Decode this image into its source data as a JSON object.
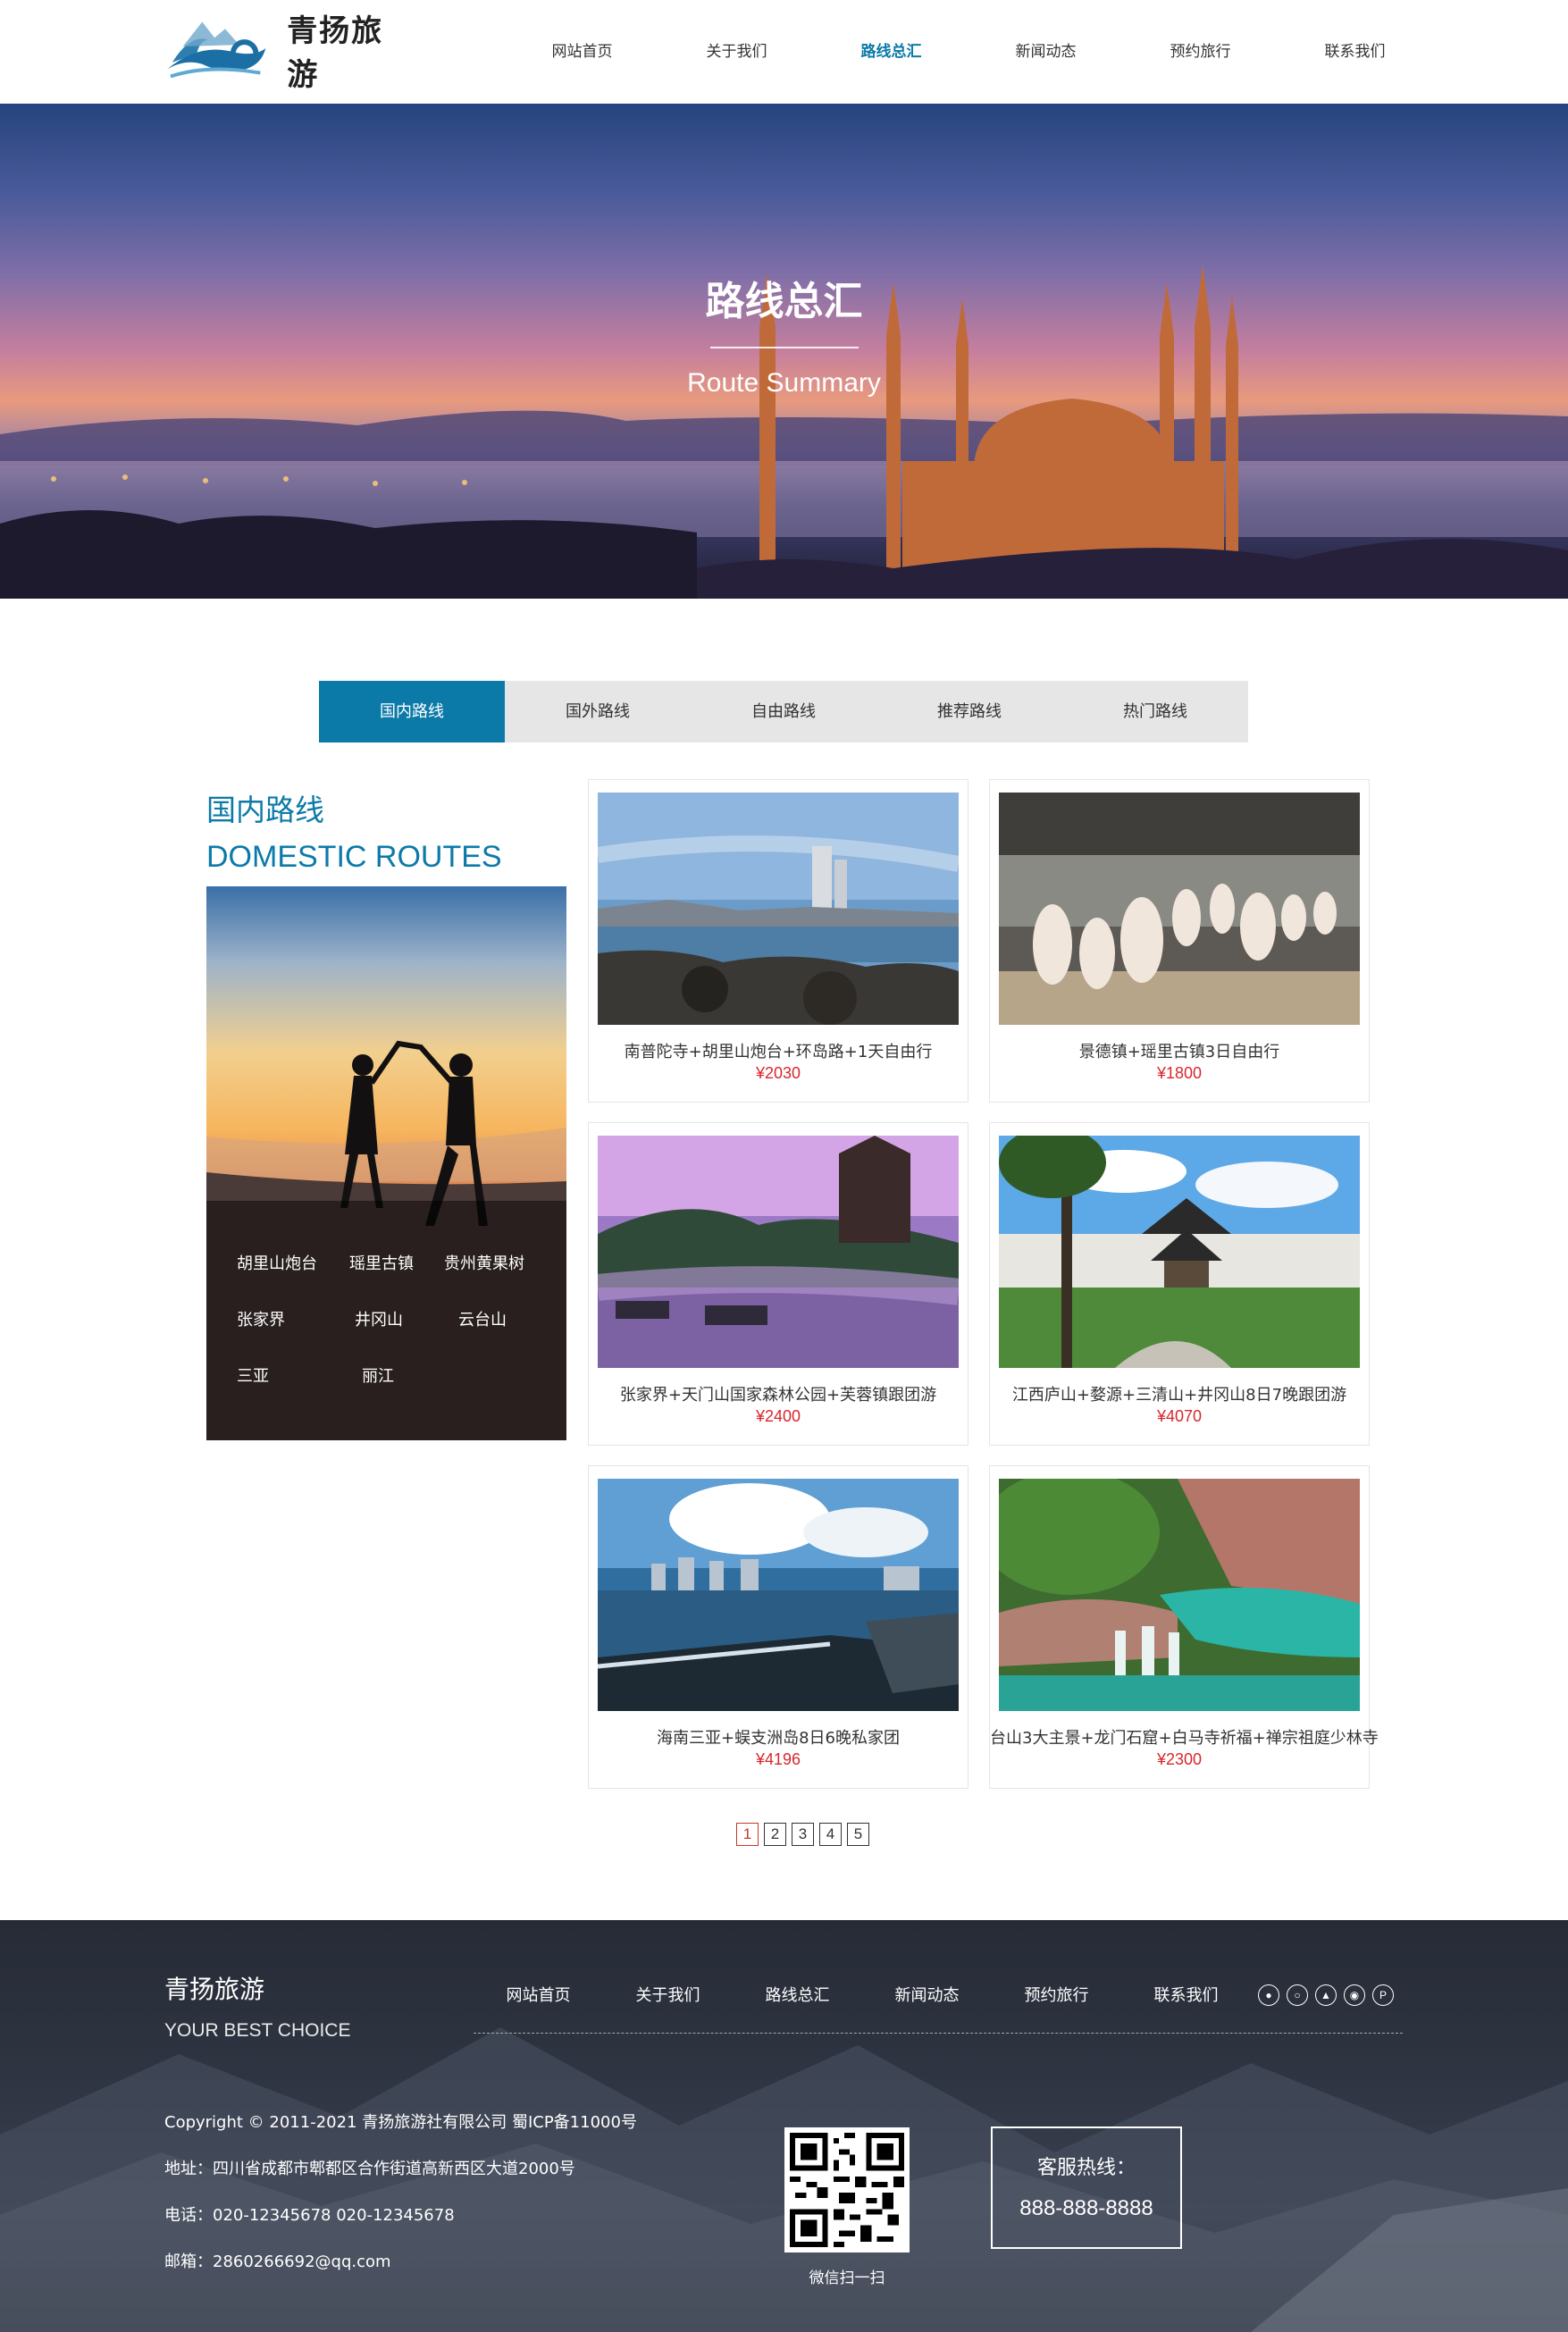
{
  "header": {
    "brand": "青扬旅游",
    "nav": [
      "网站首页",
      "关于我们",
      "路线总汇",
      "新闻动态",
      "预约旅行",
      "联系我们"
    ],
    "active_nav": 2
  },
  "banner": {
    "title": "路线总汇",
    "subtitle": "Route Summary"
  },
  "tabs": [
    "国内路线",
    "国外路线",
    "自由路线",
    "推荐路线",
    "热门路线"
  ],
  "sidebar": {
    "title_cn": "国内路线",
    "title_en": "DOMESTIC ROUTES",
    "tags": [
      "胡里山炮台",
      "瑶里古镇",
      "贵州黄果树",
      "张家界",
      "井冈山",
      "云台山",
      "三亚",
      "丽江"
    ]
  },
  "routes": [
    {
      "name": "南普陀寺+胡里山炮台+环岛路+1天自由行",
      "price": "¥2030"
    },
    {
      "name": "景德镇+瑶里古镇3日自由行",
      "price": "¥1800"
    },
    {
      "name": "张家界+天门山国家森林公园+芙蓉镇跟团游",
      "price": "¥2400"
    },
    {
      "name": "江西庐山+婺源+三清山+井冈山8日7晚跟团游",
      "price": "¥4070"
    },
    {
      "name": "海南三亚+蜈支洲岛8日6晚私家团",
      "price": "¥4196"
    },
    {
      "name": "台山3大主景+龙门石窟+白马寺祈福+禅宗祖庭少林寺",
      "price": "¥2300"
    }
  ],
  "pagination": [
    "1",
    "2",
    "3",
    "4",
    "5"
  ],
  "footer": {
    "brand": "青扬旅游",
    "slogan": "YOUR BEST CHOICE",
    "nav": [
      "网站首页",
      "关于我们",
      "路线总汇",
      "新闻动态",
      "预约旅行",
      "联系我们"
    ],
    "copyright": "Copyright © 2011-2021 青扬旅游社有限公司 蜀ICP备11000号",
    "address": "地址：四川省成都市郫都区合作街道高新西区大道2000号",
    "phone": "电话：020-12345678 020-12345678",
    "email": "邮箱：2860266692@qq.com",
    "qr_caption": "微信扫一扫",
    "hotline_label": "客服热线：",
    "hotline_number": "888-888-8888",
    "social_icons": [
      "qq-icon",
      "wechat-icon",
      "people-icon",
      "weibo-icon",
      "pinterest-icon"
    ]
  },
  "colors": {
    "accent": "#0c7aa8",
    "price": "#d8262d",
    "tab_bg": "#e6e6e6"
  }
}
